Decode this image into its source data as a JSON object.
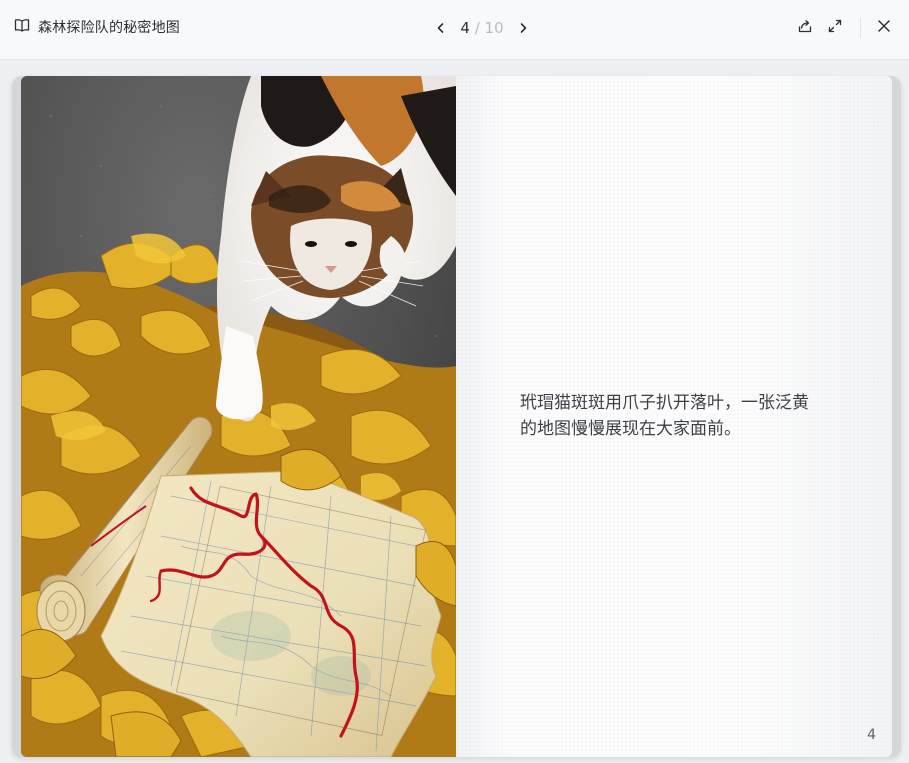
{
  "app": {
    "title": "森林探险队的秘密地图",
    "icons": {
      "book": "book-open-icon",
      "prev": "chevron-left-icon",
      "next": "chevron-right-icon",
      "share": "share-icon",
      "fullscreen": "expand-icon",
      "close": "close-icon"
    }
  },
  "pager": {
    "current": "4",
    "separator": "/",
    "total": "10"
  },
  "book": {
    "illustration": "calico-cat-with-treasure-map",
    "story_text": "玳瑁猫斑斑用爪子扒开落叶，一张泛黄的地图慢慢展现在大家面前。",
    "page_number": "4"
  },
  "colors": {
    "toolbar_bg": "#f8f9fb",
    "accent_route": "#c4121c",
    "page_bg": "#fbfbfc"
  }
}
